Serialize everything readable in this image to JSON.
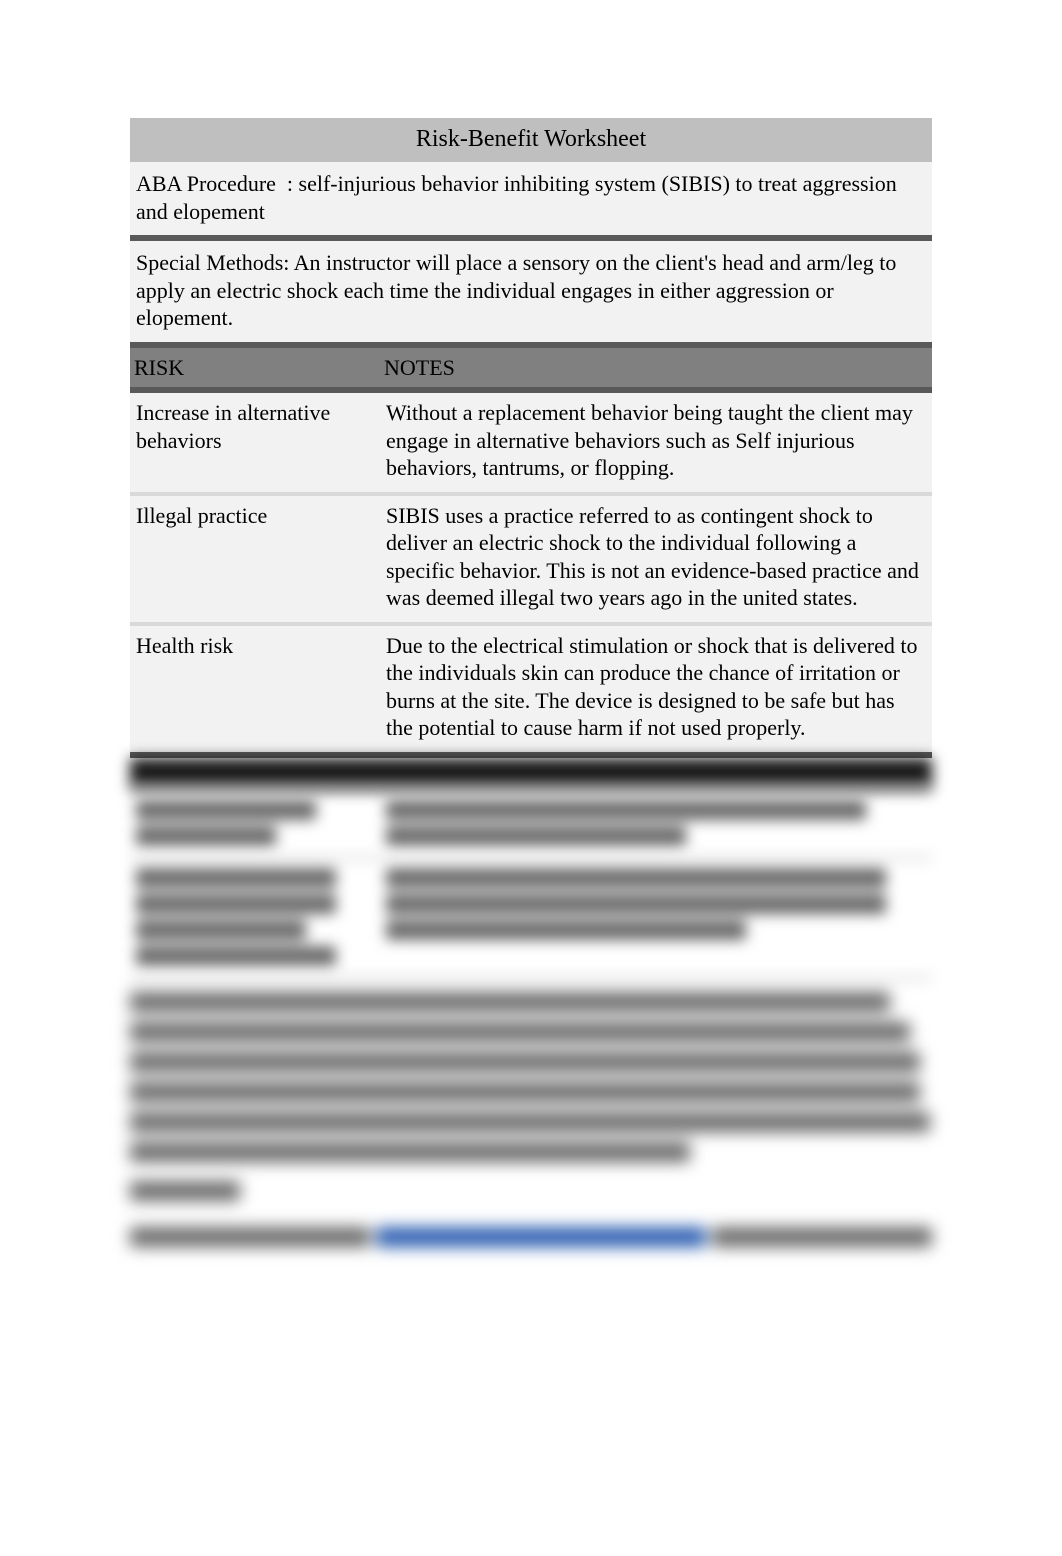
{
  "title": "Risk-Benefit Worksheet",
  "procedure": "ABA Procedure  : self-injurious behavior inhibiting system (SIBIS) to treat aggression and elopement",
  "special_methods": "Special Methods: An instructor will place a sensory on the client's head and arm/leg to apply an electric shock each time the individual engages in either aggression or elopement.",
  "headers": {
    "risk": "RISK",
    "notes": "NOTES"
  },
  "rows": [
    {
      "risk": "Increase in alternative behaviors",
      "notes": "Without a replacement behavior being taught the client may engage in alternative behaviors such as Self injurious behaviors, tantrums, or flopping."
    },
    {
      "risk": "Illegal practice",
      "notes": "SIBIS uses a practice referred to as contingent shock to deliver an electric shock to the individual following a specific behavior. This is not an evidence-based practice and was deemed illegal two years ago in the united states."
    },
    {
      "risk": "Health risk",
      "notes": "Due to the electrical stimulation or shock that is delivered to the individuals skin can produce the chance of irritation or burns at the site. The device is designed to be safe but has the potential to cause harm if not used properly."
    }
  ],
  "blurred_rows": [
    {
      "left_widths": [
        180,
        140
      ],
      "right_widths": [
        480,
        300
      ]
    },
    {
      "left_widths": [
        200,
        200,
        170,
        200
      ],
      "right_widths": [
        500,
        500,
        360
      ]
    }
  ],
  "blurred_paragraph_widths": [
    760,
    780,
    790,
    790,
    800,
    560
  ],
  "references_label_width": 110,
  "reference_line": {
    "seg1_width": 240,
    "link_width": 330,
    "seg2_width": 220
  }
}
